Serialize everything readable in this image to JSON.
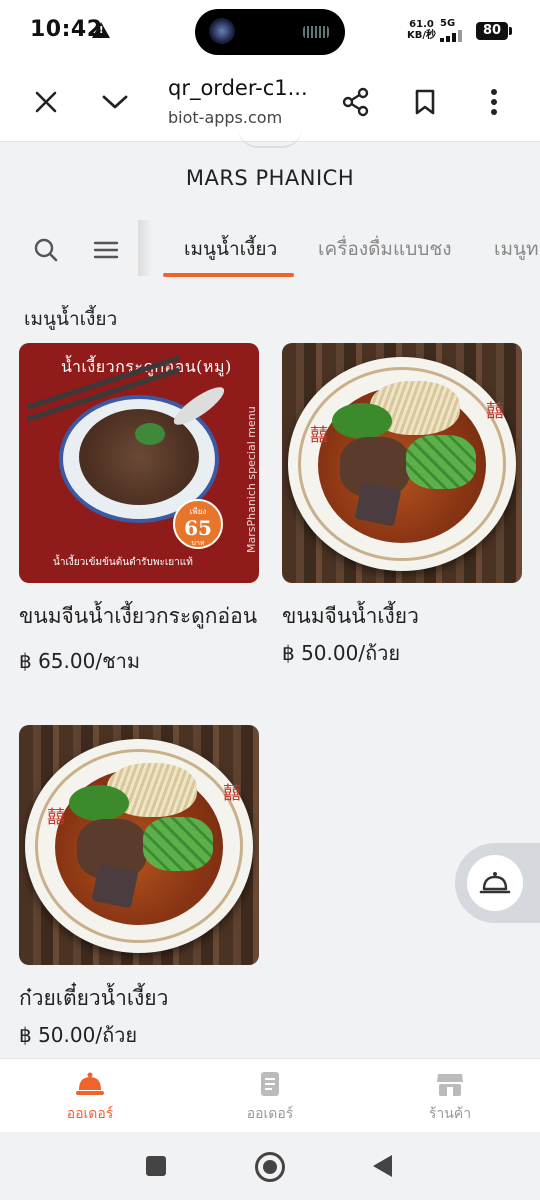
{
  "status_bar": {
    "time": "10:42",
    "net_speed": "61.0",
    "net_unit": "KB/秒",
    "network": "5G",
    "battery": "80"
  },
  "browser": {
    "title": "qr_order-c1...",
    "url": "biot-apps.com",
    "icons": [
      "close-icon",
      "chevron-down-icon",
      "share-icon",
      "bookmark-icon",
      "more-vert-icon"
    ]
  },
  "store": {
    "name": "MARS PHANICH"
  },
  "categories": {
    "tabs": [
      {
        "label": "เมนูน้ำเงี้ยว",
        "active": true
      },
      {
        "label": "เครื่องดื่มแบบชง",
        "active": false
      },
      {
        "label": "เมนูทา",
        "active": false
      }
    ]
  },
  "section": {
    "title": "เมนูน้ำเงี้ยว"
  },
  "items": [
    {
      "name": "ขนมจีนน้ำเงี้ยวกระดูกอ่อน",
      "price": "฿ 65.00/ชาม",
      "poster": {
        "title": "น้ำเงี้ยวกระดูกอ่อน(หมู)",
        "badge_small": "เพียง",
        "badge_price": "65",
        "badge_unit": "บาท",
        "side_text": "MarsPhanich special menu",
        "footer": "น้ำเงี้ยวเข้มข้นต้นตำรับพะเยาแท้"
      }
    },
    {
      "name": "ขนมจีนน้ำเงี้ยว",
      "price": "฿ 50.00/ถ้วย"
    },
    {
      "name": "ก๋วยเตี๋ยวน้ำเงี้ยว",
      "price": "฿ 50.00/ถ้วย"
    }
  ],
  "floating_button": {
    "icon": "bell-icon"
  },
  "bottom_nav": [
    {
      "label": "ออเดอร์",
      "icon": "food-cover-icon",
      "active": true
    },
    {
      "label": "ออเดอร์",
      "icon": "receipt-icon",
      "active": false
    },
    {
      "label": "ร้านค้า",
      "icon": "store-icon",
      "active": false
    }
  ],
  "colors": {
    "accent": "#f0632b",
    "poster_red": "#8f1c1a"
  }
}
